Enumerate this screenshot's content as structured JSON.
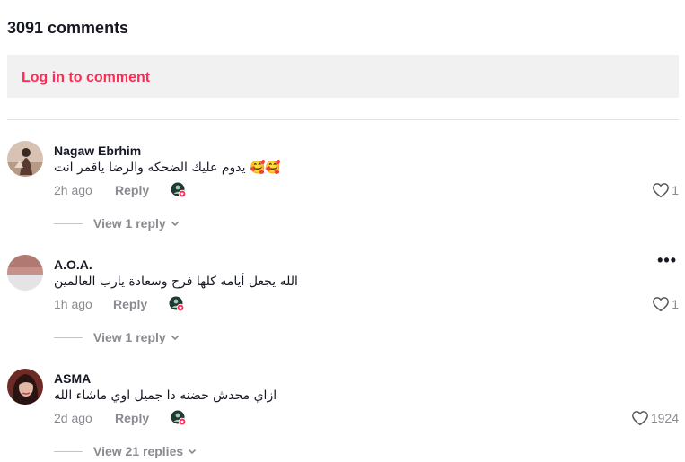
{
  "header": {
    "comment_count": "3091 comments"
  },
  "login": {
    "label": "Log in to comment",
    "color": "#fe2c55"
  },
  "comments": [
    {
      "username": "Nagaw Ebrhim",
      "text": "يدوم عليك الضحكه والرضا ياقمر انت 🥰🥰",
      "time": "2h ago",
      "reply_label": "Reply",
      "likes": "1",
      "view_replies": "View 1 reply",
      "avatar_icon": "user-avatar"
    },
    {
      "username": "A.O.A.",
      "text": "الله يجعل أيامه كلها فرح وسعادة يارب العالمين",
      "time": "1h ago",
      "reply_label": "Reply",
      "likes": "1",
      "view_replies": "View 1 reply",
      "more_label": "•••",
      "avatar_icon": "user-avatar"
    },
    {
      "username": "ASMA",
      "text": "ازاي محدش حضنه دا جميل اوي ماشاء الله",
      "time": "2d ago",
      "reply_label": "Reply",
      "likes": "1924",
      "view_replies": "View 21 replies",
      "avatar_icon": "user-avatar"
    }
  ],
  "icons": {
    "like": "heart-icon",
    "creator_liked": "creator-liked-icon",
    "expand": "chevron-down-icon",
    "more": "more-options-icon"
  }
}
